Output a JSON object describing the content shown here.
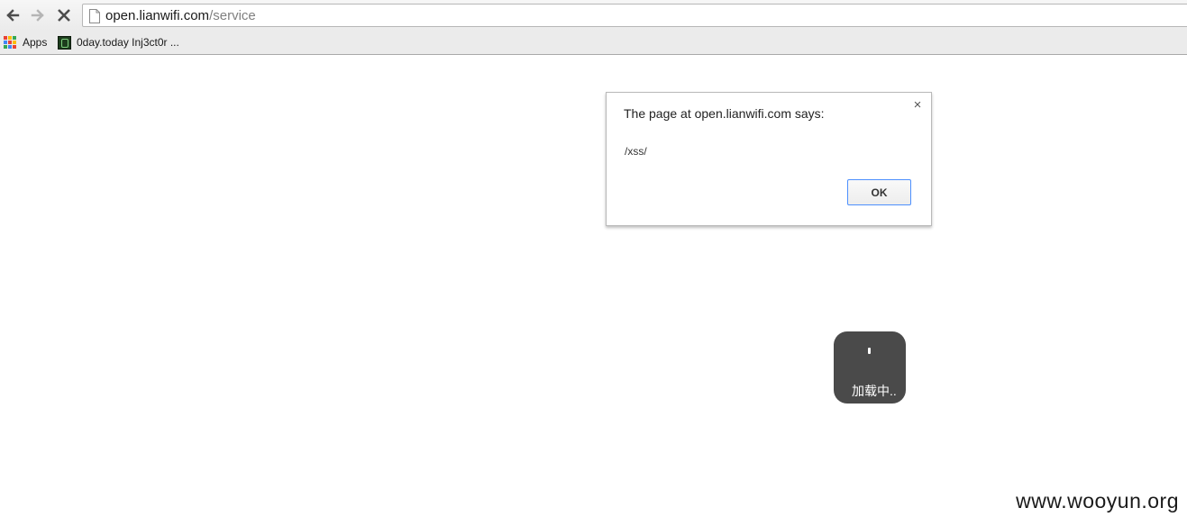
{
  "browser": {
    "url_host": "open.lianwifi.com",
    "url_path": "/service",
    "nav_icons": [
      "back-arrow-icon",
      "forward-arrow-icon",
      "stop-icon"
    ],
    "bookmarks": [
      {
        "label": "Apps",
        "icon": "apps-grid-icon"
      },
      {
        "label": "0day.today Inj3ct0r ...",
        "icon": "0day-favicon-icon"
      }
    ]
  },
  "dialog": {
    "title": "The page at open.lianwifi.com says:",
    "message": "/xss/",
    "ok_label": "OK",
    "close_glyph": "×"
  },
  "loading": {
    "text": "加载中.."
  },
  "watermark": "www.wooyun.org",
  "colors": {
    "toolbar": "#f0f0f0",
    "dialog_focus_border": "#4d90fe",
    "loading_bg": "#4a4a4a"
  }
}
